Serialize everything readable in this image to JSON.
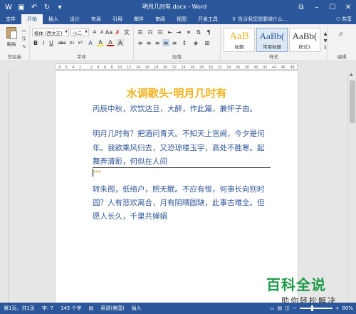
{
  "titlebar": {
    "doc_title": "明月几时有.docx - Word",
    "icons": [
      "save-icon",
      "undo-icon",
      "redo-icon",
      "customize-icon"
    ]
  },
  "tabs": {
    "items": [
      "文件",
      "开始",
      "插入",
      "设计",
      "布局",
      "引用",
      "邮件",
      "审阅",
      "视图",
      "开发工具"
    ],
    "active": "开始",
    "tellme": "告诉我您想要做什么...",
    "share": "共享"
  },
  "ribbon": {
    "clipboard": {
      "paste": "粘贴",
      "label": "剪贴板"
    },
    "font": {
      "name": "楷体 (西文正)",
      "size": "小二",
      "label": "字体",
      "buttons": [
        "B",
        "I",
        "U",
        "abc",
        "x₂",
        "x²",
        "A",
        "A",
        "A",
        "A"
      ]
    },
    "paragraph": {
      "label": "段落"
    },
    "styles": {
      "label": "样式",
      "items": [
        {
          "preview": "AaB",
          "name": "标题"
        },
        {
          "preview": "AaBb(",
          "name": "常用标题"
        },
        {
          "preview": "AaBb(",
          "name": "样式1"
        }
      ]
    },
    "editing": {
      "label": "编辑"
    }
  },
  "ruler": {
    "numbers": [
      "8",
      "6",
      "4",
      "2",
      "",
      "2",
      "4",
      "6",
      "8",
      "10",
      "12",
      "14",
      "16",
      "18",
      "20",
      "22",
      "24",
      "26",
      "28",
      "30",
      "32",
      "34",
      "36",
      "38",
      "40",
      "42",
      "44",
      "46",
      "48"
    ]
  },
  "document": {
    "heading": "水调歌头·明月几时有",
    "p1": "丙辰中秋，欢饮达旦，大醉，作此篇，兼怀子由。",
    "p2_l1": "明月几时有？把酒问青天。不知天上宫阙，今夕是何",
    "p2_l2": "年。我欲乘风归去，又恐琼楼玉宇，高处不胜寒。起",
    "p2_l3": "舞弄清影，何似在人间",
    "stars": "***",
    "p3_l1": "转朱阁，低绮户，照无眠。不应有恨，何事长向别时",
    "p3_l2": "园？人有悲欢离合，月有阴晴圆缺，此事古难全。但",
    "p3_l3": "愿人长久，千里共婵娟"
  },
  "statusbar": {
    "page": "第1页，共1页",
    "words": "字: 7",
    "chars": "145 个字",
    "lang": "英语(美国)",
    "mode": "插入",
    "zoom": "80%",
    "zoom_level": 0.8
  },
  "watermark": {
    "big": "百科全说",
    "small": "助你轻松解决"
  },
  "colors": {
    "accent": "#2b579a",
    "heading": "#f5b21f",
    "body_text": "#2f5597",
    "watermark": "#1f9a4a"
  }
}
